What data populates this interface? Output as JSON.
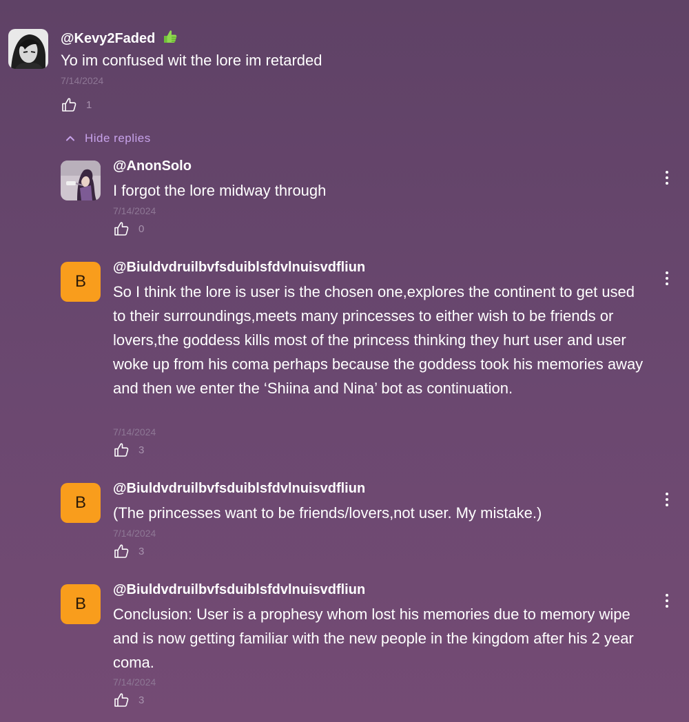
{
  "colors": {
    "background_top": "#5f4266",
    "background_bottom": "#744b74",
    "accent": "#c7a2ea",
    "letter_avatar": "#f99d1c",
    "muted_text": "#8e7795"
  },
  "main_comment": {
    "username": "@Kevy2Faded",
    "badge_icon": "thumbs-up-emoji",
    "text": "Yo im confused wit the lore im retarded",
    "date": "7/14/2024",
    "likes": "1",
    "avatar": "anime-avatar"
  },
  "hide_replies": {
    "label": "Hide replies",
    "icon": "chevron-up-icon"
  },
  "replies": [
    {
      "username": "@AnonSolo",
      "text": "I forgot the lore midway through",
      "date": "7/14/2024",
      "likes": "0",
      "avatar": "photo-avatar"
    },
    {
      "username": "@Biuldvdruilbvfsduiblsfdvlnuisvdfliun",
      "avatar_letter": "B",
      "text": "So I think the lore is user is the chosen one,explores the continent to get used to their surroundings,meets many princesses to either wish to be friends or lovers,the goddess kills most of the princess thinking they hurt user and user woke up from his coma perhaps because the goddess took his memories away and then we enter the ‘Shiina and Nina’ bot as continuation.",
      "date": "7/14/2024",
      "likes": "3"
    },
    {
      "username": "@Biuldvdruilbvfsduiblsfdvlnuisvdfliun",
      "avatar_letter": "B",
      "text": "(The princesses want to be friends/lovers,not user. My mistake.)",
      "date": "7/14/2024",
      "likes": "3"
    },
    {
      "username": "@Biuldvdruilbvfsduiblsfdvlnuisvdfliun",
      "avatar_letter": "B",
      "text": "Conclusion: User is a prophesy whom lost his memories due to memory wipe and is now getting familiar with the new people in the kingdom after his 2 year coma.",
      "date": "7/14/2024",
      "likes": "3"
    }
  ]
}
